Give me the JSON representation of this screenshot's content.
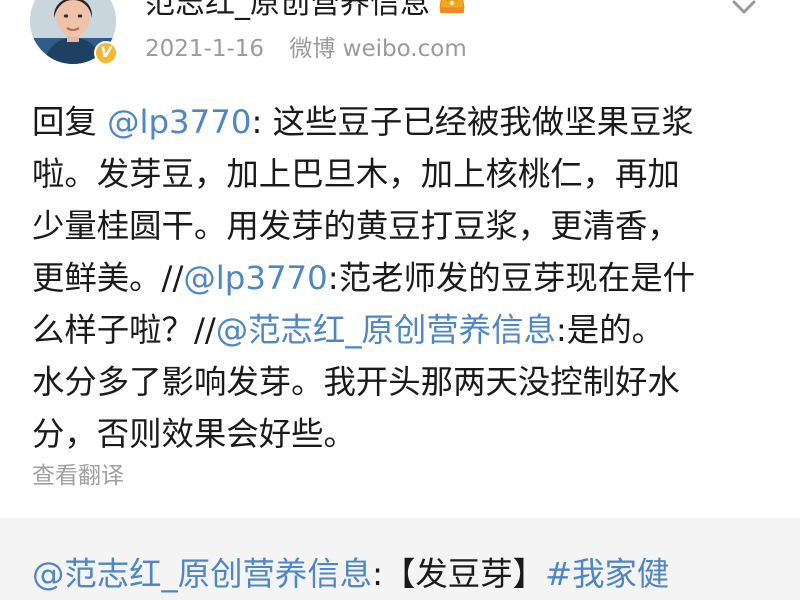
{
  "post": {
    "author": "范志红_原创营养信息",
    "date": "2021-1-16",
    "source": "微博 weibo.com",
    "verified_badge": "V",
    "icons": {
      "avatar": "avatar-photo",
      "verified": "verified-v-icon",
      "crown": "crown-icon",
      "menu": "chevron-down-icon"
    }
  },
  "content": {
    "line1": {
      "prefix": "回复 ",
      "mention": "@lp3770",
      "text": ": 这些豆子已经被我做坚果豆浆"
    },
    "line2": "啦。发芽豆，加上巴旦木，加上核桃仁，再加",
    "line3": "少量桂圆干。用发芽的黄豆打豆浆，更清香，",
    "line4": {
      "prefix": "更鲜美。//",
      "mention": "@lp3770",
      "text": ":范老师发的豆芽现在是什"
    },
    "line5": {
      "prefix": "么样子啦？//",
      "mention": "@范志红_原创营养信息",
      "text": ":是的。"
    },
    "line6": "水分多了影响发芽。我开头那两天没控制好水",
    "line7": "分，否则效果会好些。"
  },
  "translate_label": "查看翻译",
  "repost": {
    "mention": "@范志红_原创营养信息",
    "text": ":【发豆芽】",
    "hashtag": "#我家健"
  },
  "colors": {
    "link": "#4e86c6",
    "badge": "#f7b733",
    "meta": "#9b9b9b",
    "repost_bg": "#f4f4f4"
  }
}
